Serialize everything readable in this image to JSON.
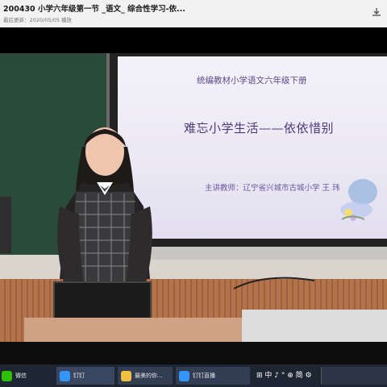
{
  "window": {
    "title": "200430 小学六年级第一节 _语文_ 综合性学习-依...",
    "subtitle": "最后更新：2020/05/05 播放"
  },
  "slide": {
    "top_line": "统编教材小学语文六年级下册",
    "main_title": "难忘小学生活——依依惜别",
    "teacher_line": "主讲教师：辽宁省兴城市古城小学  王  玮"
  },
  "taskbar": {
    "items": [
      {
        "label": "微信",
        "icon": "wechat-icon",
        "color": "#2dc100"
      },
      {
        "label": "钉钉",
        "icon": "dingtalk-icon",
        "color": "#3296fa"
      },
      {
        "label": "最美的你...",
        "icon": "folder-icon",
        "color": "#f0c040"
      },
      {
        "label": "钉钉直播",
        "icon": "live-icon",
        "color": "#3296fa"
      }
    ],
    "tray": {
      "text": "⊞ 中 ♪ ° ⊕ 简 ⚙"
    }
  },
  "colors": {
    "accent": "#5b4a8a",
    "taskbar": "#1f2633"
  }
}
